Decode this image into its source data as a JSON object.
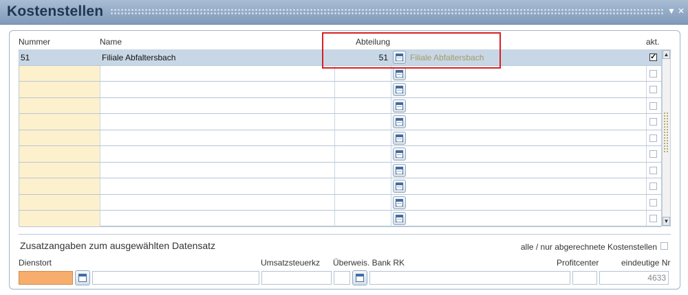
{
  "window": {
    "title": "Kostenstellen"
  },
  "grid": {
    "columns": {
      "nummer": "Nummer",
      "name": "Name",
      "abteilung": "Abteilung",
      "akt": "akt."
    },
    "rows": [
      {
        "nummer": "51",
        "name": "Filiale Abfaltersbach",
        "abteilung": "51",
        "abteilung_name": "Filiale Abfaltersbach",
        "akt": true,
        "selected": true
      },
      {
        "nummer": "",
        "name": "",
        "abteilung": "",
        "abteilung_name": "",
        "akt": false
      },
      {
        "nummer": "",
        "name": "",
        "abteilung": "",
        "abteilung_name": "",
        "akt": false
      },
      {
        "nummer": "",
        "name": "",
        "abteilung": "",
        "abteilung_name": "",
        "akt": false
      },
      {
        "nummer": "",
        "name": "",
        "abteilung": "",
        "abteilung_name": "",
        "akt": false
      },
      {
        "nummer": "",
        "name": "",
        "abteilung": "",
        "abteilung_name": "",
        "akt": false
      },
      {
        "nummer": "",
        "name": "",
        "abteilung": "",
        "abteilung_name": "",
        "akt": false
      },
      {
        "nummer": "",
        "name": "",
        "abteilung": "",
        "abteilung_name": "",
        "akt": false
      },
      {
        "nummer": "",
        "name": "",
        "abteilung": "",
        "abteilung_name": "",
        "akt": false
      },
      {
        "nummer": "",
        "name": "",
        "abteilung": "",
        "abteilung_name": "",
        "akt": false
      },
      {
        "nummer": "",
        "name": "",
        "abteilung": "",
        "abteilung_name": "",
        "akt": false
      }
    ]
  },
  "details": {
    "section_title": "Zusatzangaben zum ausgewählten Datensatz",
    "filter_label": "alle / nur abgerechnete Kostenstellen",
    "labels": {
      "dienstort": "Dienstort",
      "umsatzsteuerkz": "Umsatzsteuerkz",
      "ueberweis": "Überweis. Bank RK",
      "profitcenter": "Profitcenter",
      "eindeutige_nr": "eindeutige Nr"
    },
    "values": {
      "dienstort": "",
      "dienstort_name": "",
      "umsatzsteuerkz": "",
      "ueberweis_code": "",
      "ueberweis_name": "",
      "profitcenter": "",
      "eindeutige_nr": "4633"
    }
  },
  "icons": {
    "lookup": "calendar-lookup-icon",
    "checkmark": "check-icon",
    "scroll_up": "scroll-up-icon",
    "scroll_down": "scroll-down-icon"
  },
  "colors": {
    "title_bar": "#7f9ab9",
    "selected_row": "#c8d7e6",
    "key_column": "#fdf0cd",
    "required_field": "#f7ad6c",
    "highlight": "#d62020"
  }
}
